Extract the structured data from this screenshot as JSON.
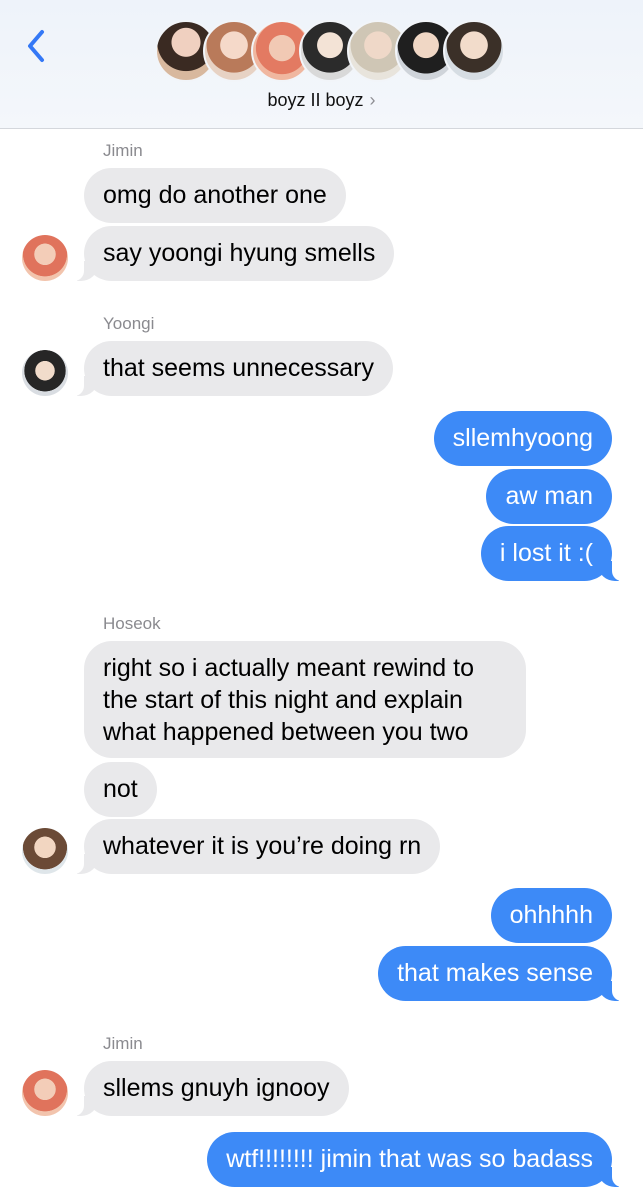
{
  "header": {
    "group_name": "boyz II boyz",
    "chevron": "›",
    "member_avatars": [
      "avatar-1",
      "avatar-2",
      "avatar-3",
      "avatar-4",
      "avatar-5",
      "avatar-6",
      "avatar-7"
    ]
  },
  "colors": {
    "incoming_bubble": "#e9e9eb",
    "outgoing_bubble": "#3d8af7",
    "back_chevron": "#3478f6"
  },
  "messages": [
    {
      "sender": "Jimin"
    },
    {
      "text": "omg do another one"
    },
    {
      "text": "say yoongi hyung smells"
    },
    {
      "sender": "Yoongi"
    },
    {
      "text": "that seems unnecessary"
    },
    {
      "text": "sllemhyoong"
    },
    {
      "text": "aw man"
    },
    {
      "text": "i lost it :("
    },
    {
      "sender": "Hoseok"
    },
    {
      "text": "right so i actually meant rewind to the start of this night and explain what happened between you two"
    },
    {
      "text": "not"
    },
    {
      "text": "whatever it is you’re doing rn"
    },
    {
      "text": "ohhhhh"
    },
    {
      "text": "that makes sense"
    },
    {
      "sender": "Jimin"
    },
    {
      "text": "sllems gnuyh ignooy"
    },
    {
      "text": "wtf!!!!!!!! jimin that was so badass"
    }
  ]
}
